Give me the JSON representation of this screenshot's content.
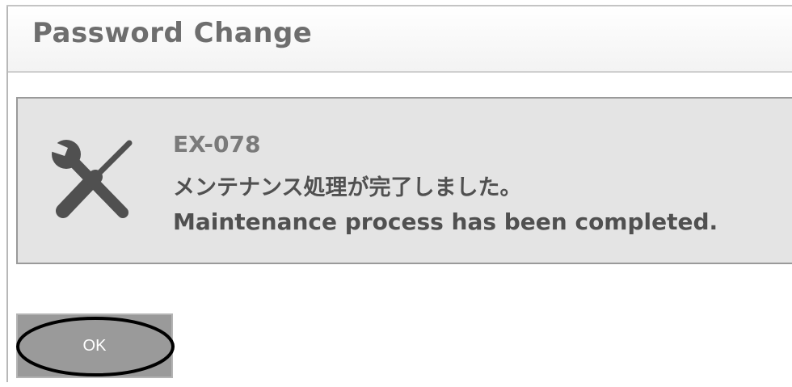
{
  "dialog": {
    "title": "Password Change"
  },
  "message": {
    "icon": "maintenance-tools-icon",
    "code": "EX-078",
    "text_jp": "メンテナンス処理が完了しました。",
    "text_en": "Maintenance process has been completed."
  },
  "buttons": {
    "ok_label": "OK"
  },
  "colors": {
    "message_background": "#e4e4e4",
    "button_background": "#9a9a9a",
    "title_text": "#6e6e6e"
  }
}
